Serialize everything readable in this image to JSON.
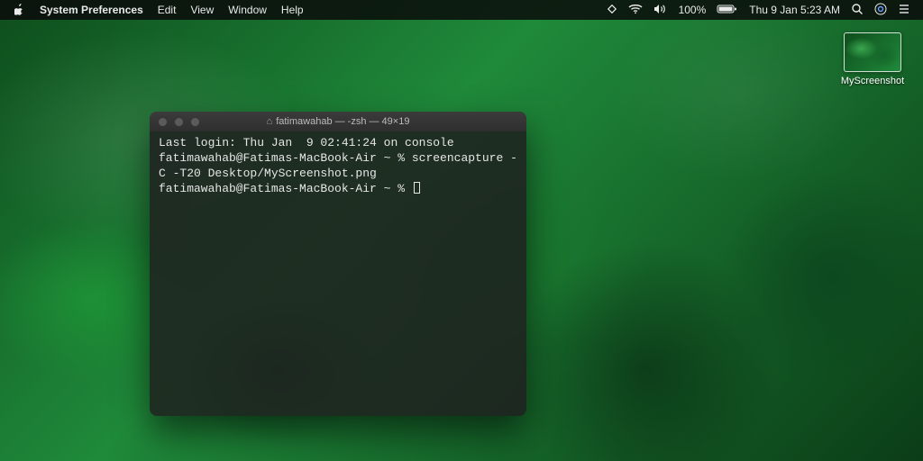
{
  "menubar": {
    "app_name": "System Preferences",
    "items": [
      "Edit",
      "View",
      "Window",
      "Help"
    ],
    "battery_pct": "100%",
    "clock": "Thu 9 Jan  5:23 AM"
  },
  "desktop_icon": {
    "label": "MyScreenshot"
  },
  "terminal": {
    "title_home_glyph": "⌂",
    "title": "fatimawahab — -zsh — 49×19",
    "lines": [
      "Last login: Thu Jan  9 02:41:24 on console",
      "fatimawahab@Fatimas-MacBook-Air ~ % screencapture -C -T20 Desktop/MyScreenshot.png",
      "fatimawahab@Fatimas-MacBook-Air ~ % "
    ]
  }
}
